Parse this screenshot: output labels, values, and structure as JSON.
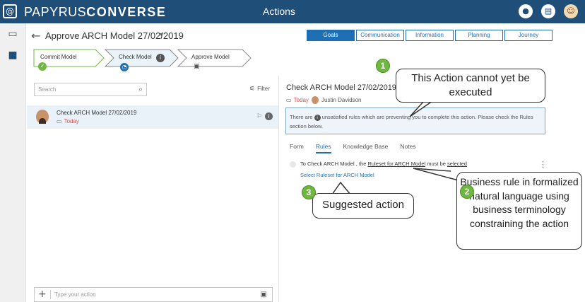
{
  "topbar": {
    "brand_light": "PAPYRUS",
    "brand_bold": "CONVERSE",
    "title": "Actions",
    "icons": [
      "user-circle-icon",
      "chat-icon",
      "user-avatar"
    ]
  },
  "header": {
    "back": "←",
    "title": "Approve ARCH Model 27/02/2019",
    "caret": "▾",
    "tabs": [
      {
        "label": "Goals",
        "active": true
      },
      {
        "label": "Communication",
        "active": false
      },
      {
        "label": "Information",
        "active": false
      },
      {
        "label": "Planning",
        "active": false
      },
      {
        "label": "Journey",
        "active": false
      }
    ]
  },
  "stepper": [
    {
      "label": "Commit Model",
      "status": "done"
    },
    {
      "label": "Check Model",
      "status": "in-progress"
    },
    {
      "label": "Approve Model",
      "status": "locked"
    }
  ],
  "list": {
    "search_placeholder": "Search",
    "filter_label": "Filter",
    "items": [
      {
        "name": "Check ARCH Model 27/02/2019",
        "date": "Today"
      }
    ],
    "composer_placeholder": "Type your action"
  },
  "detail": {
    "title": "Check ARCH Model 27/02/2019",
    "date": "Today",
    "assignee": "Justin Davidson",
    "warning_pre": "There are",
    "warning_post": "unsatisfied rules which are preventing you to complete this action. Please check the Rules section below.",
    "tabs": [
      {
        "label": "Form",
        "active": false
      },
      {
        "label": "Rules",
        "active": true
      },
      {
        "label": "Knowledge Base",
        "active": false
      },
      {
        "label": "Notes",
        "active": false
      }
    ],
    "rule": {
      "pre": "To Check ARCH Model , the",
      "link": "Ruleset for ARCH Model",
      "mid": "must be",
      "link2": "selected"
    },
    "suggestion": "Select Ruleset for ARCH Model"
  },
  "callouts": [
    {
      "num": "1",
      "text": "This Action cannot yet be executed"
    },
    {
      "num": "2",
      "text": "Business rule in formalized natural language using business terminology constraining the action"
    },
    {
      "num": "3",
      "text": "Suggested action"
    }
  ],
  "colors": {
    "topbar": "#1f4e79",
    "accent": "#1f6fb5",
    "callout_badge": "#6fb83f",
    "today": "#d9534f"
  }
}
